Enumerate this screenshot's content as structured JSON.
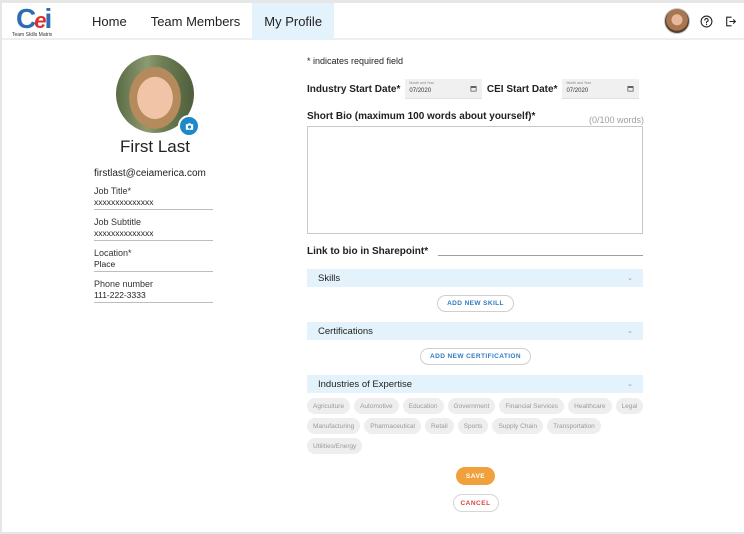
{
  "app": {
    "logo_text": "cei",
    "logo_subtitle": "Team Skills Matrix"
  },
  "nav": {
    "items": [
      {
        "label": "Home",
        "active": false
      },
      {
        "label": "Team Members",
        "active": false
      },
      {
        "label": "My Profile",
        "active": true
      }
    ]
  },
  "header_icons": {
    "avatar": "user-avatar",
    "help": "help-icon",
    "logout": "logout-icon"
  },
  "profile": {
    "name": "First Last",
    "email": "firstlast@ceiamerica.com",
    "camera_icon": "camera-icon",
    "fields": [
      {
        "label": "Job Title*",
        "value": "xxxxxxxxxxxxxx"
      },
      {
        "label": "Job Subtitle",
        "value": "xxxxxxxxxxxxxx"
      },
      {
        "label": "Location*",
        "value": "Place"
      },
      {
        "label": "Phone number",
        "value": "111-222-3333"
      }
    ]
  },
  "form": {
    "required_note": "* indicates required field",
    "industry_start": {
      "label": "Industry Start Date*",
      "placeholder": "Month and Year",
      "value": "07/2020"
    },
    "cei_start": {
      "label": "CEI Start Date*",
      "placeholder": "Month and Year",
      "value": "07/2020"
    },
    "bio": {
      "label": "Short Bio (maximum 100 words about yourself)*",
      "count": "(0/100 words)",
      "value": ""
    },
    "sharepoint": {
      "label": "Link to bio in Sharepoint*",
      "value": ""
    },
    "skills": {
      "title": "Skills",
      "add_label": "ADD NEW SKILL"
    },
    "certifications": {
      "title": "Certifications",
      "add_label": "ADD NEW CERTIFICATION"
    },
    "industries": {
      "title": "Industries of Expertise",
      "chips": [
        "Agriculture",
        "Automotive",
        "Education",
        "Government",
        "Financial Services",
        "Healthcare",
        "Legal",
        "Manufacturing",
        "Pharmaceutical",
        "Retail",
        "Sports",
        "Supply Chain",
        "Transportation",
        "Utilities/Energy"
      ]
    },
    "save_label": "SAVE",
    "cancel_label": "CANCEL"
  },
  "colors": {
    "brand_blue": "#2d6db5",
    "brand_red": "#d9322d",
    "active_tab_bg": "#e3f2fb",
    "accordion_bg": "#e3f2fb",
    "save": "#f0a13d",
    "cancel_text": "#d9473a",
    "link_blue": "#2f7bbf"
  }
}
